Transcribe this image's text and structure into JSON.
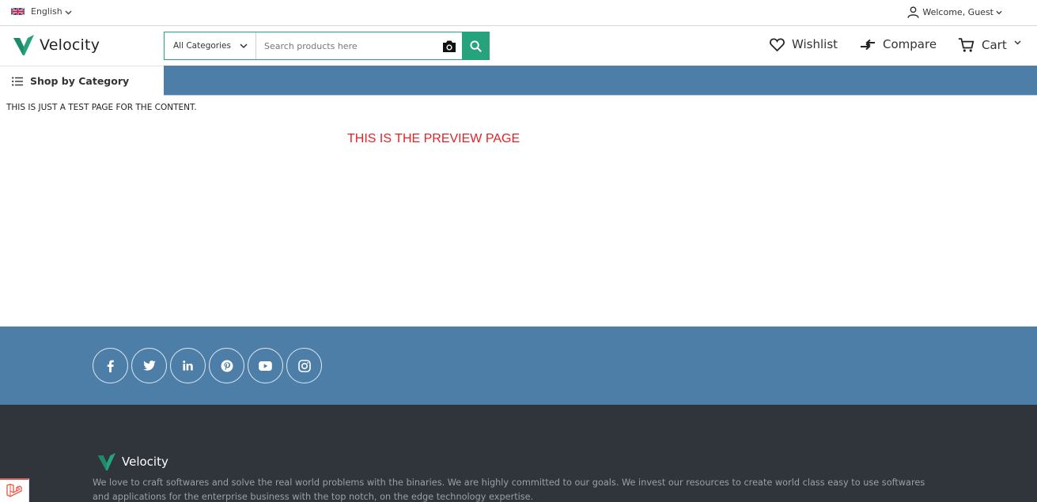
{
  "topbar": {
    "language": "English",
    "welcome": "Welcome, Guest"
  },
  "header": {
    "logo_text": "Velocity",
    "category_select": "All Categories",
    "search_placeholder": "Search products here",
    "wishlist": "Wishlist",
    "compare": "Compare",
    "cart": "Cart"
  },
  "category_bar": {
    "shop_by_category": "Shop by Category"
  },
  "main": {
    "test_text": "THIS IS JUST A TEST PAGE FOR THE CONTENT.",
    "preview_text": "THIS IS THE PREVIEW PAGE"
  },
  "social": {
    "icons": [
      "facebook-icon",
      "twitter-icon",
      "linkedin-icon",
      "pinterest-icon",
      "youtube-icon",
      "instagram-icon"
    ]
  },
  "footer": {
    "logo_text": "Velocity",
    "description": "We love to craft softwares and solve the real world problems with the binaries. We are highly committed to our goals. We invest our resources to create world class easy to use softwares and applications for the enterprise business with the top notch, on the edge technology expertise."
  },
  "colors": {
    "brand_green": "#26a37c",
    "nav_blue": "#4d7ea8",
    "footer_dark": "#2f353b",
    "preview_red": "#e32227"
  }
}
